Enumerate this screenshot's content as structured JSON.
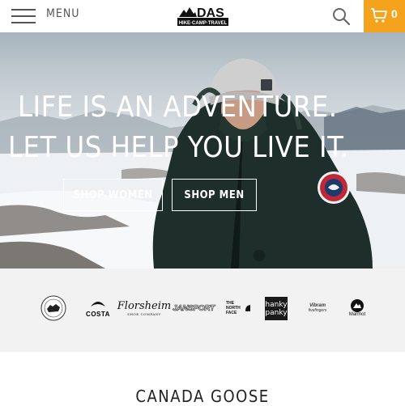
{
  "header": {
    "menu_label": "MENU",
    "logo_text": "DAS",
    "logo_tagline": "HIKE·CAMP·TRAVEL",
    "cart_count": "0",
    "accent_color": "#f5a31c"
  },
  "hero": {
    "headline_line1": "LIFE IS AN ADVENTURE.",
    "headline_line2": "LET US HELP YOU LIVE IT.",
    "shop_women_label": "SHOP WOMEN",
    "shop_men_label": "SHOP MEN"
  },
  "brands": {
    "costa": "COSTA",
    "florsheim": "Florsheim",
    "florsheim_sub": "SHOE COMPANY",
    "jansport": "JANSPORT",
    "tnf_line1": "THE NORTH",
    "tnf_line2": "FACE",
    "hanky_line1": "hanky",
    "hanky_line2": "panky",
    "vibram": "Vibram",
    "vibram_sub": "fivefingers",
    "marmot": "Marmot"
  },
  "section": {
    "title": "CANADA GOOSE"
  }
}
